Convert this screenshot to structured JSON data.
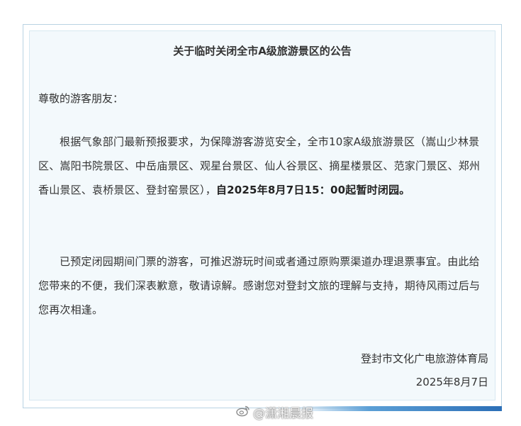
{
  "notice": {
    "title": "关于临时关闭全市A级旅游景区的公告",
    "salutation": "尊敬的游客朋友：",
    "paragraph1_normal": "根据气象部门最新预报要求，为保障游客游览安全，全市10家A级旅游景区（嵩山少林景区、嵩阳书院景区、中岳庙景区、观星台景区、仙人谷景区、摘星楼景区、范家门景区、郑州香山景区、袁桥景区、登封窑景区），",
    "paragraph1_bold": "自2025年8月7日15：00起暂时闭园。",
    "paragraph2": "已预定闭园期间门票的游客，可推迟游玩时间或者通过原购票渠道办理退票事宜。由此给您带来的不便，我们深表歉意，敬请谅解。感谢您对登封文旅的理解与支持，期待风雨过后与您再次相逢。",
    "signature_org": "登封市文化广电旅游体育局",
    "signature_date": "2025年8月7日"
  },
  "watermark": {
    "text": "@潇湘晨报"
  },
  "colors": {
    "panel_bg": "#f3f9fc",
    "frame_border": "#b9d3e3",
    "accent_blue": "#2c6fb7"
  }
}
